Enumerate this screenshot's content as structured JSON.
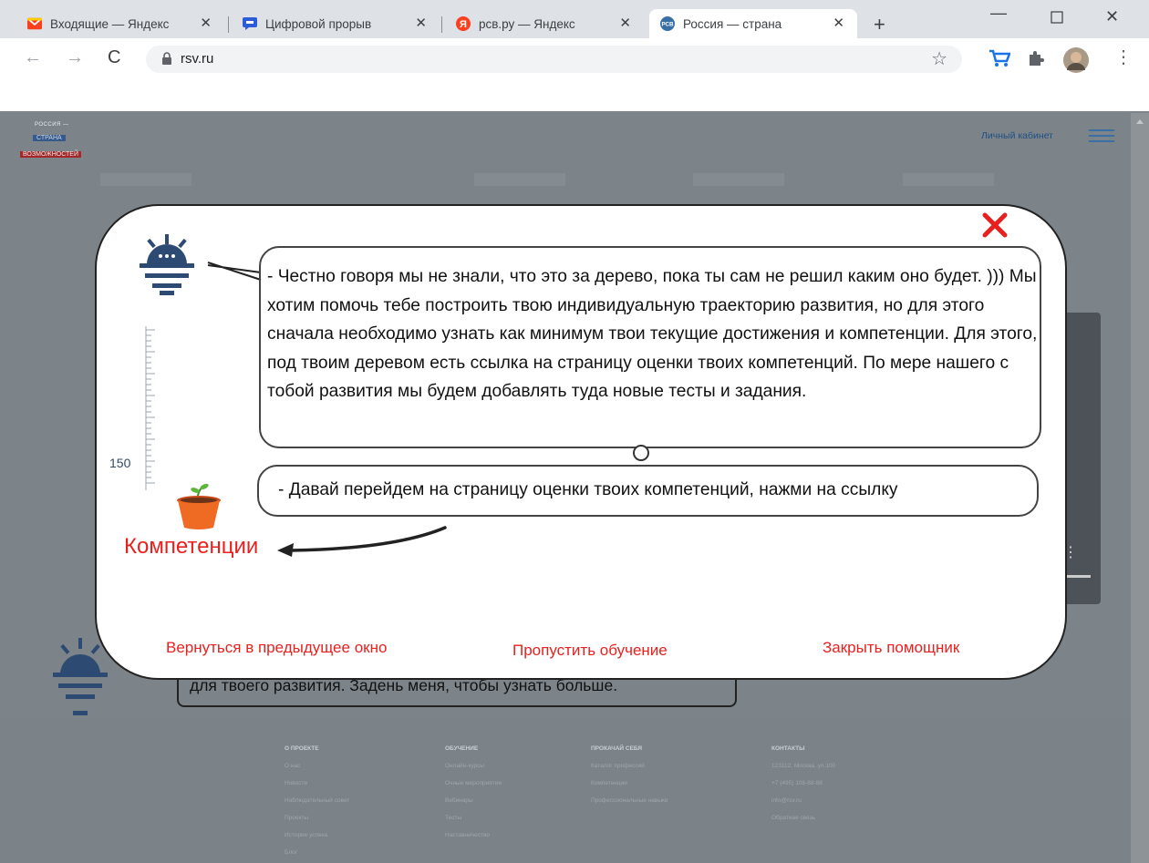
{
  "browser": {
    "tabs": [
      {
        "title": "Входящие — Яндекс",
        "icon": "mail-icon"
      },
      {
        "title": "Цифровой прорыв",
        "icon": "chat-icon"
      },
      {
        "title": "рсв.ру — Яндекс",
        "icon": "yandex-icon"
      },
      {
        "title": "Россия — страна",
        "icon": "rsv-icon",
        "active": true
      }
    ],
    "url": "rsv.ru"
  },
  "site": {
    "logo_lines": [
      "РОССИЯ —",
      "СТРАНА",
      "ВОЗМОЖНОСТЕЙ"
    ],
    "cabinet": "Личный кабинет",
    "behind_text": "для твоего развития. Задень меня, чтобы узнать больше.",
    "footer": [
      {
        "heading": "О ПРОЕКТЕ",
        "items": [
          "О нас",
          "Новости",
          "Наблюдательный совет",
          "Проекты",
          "Истории успеха",
          "Блог"
        ]
      },
      {
        "heading": "ОБУЧЕНИЕ",
        "items": [
          "Онлайн-курсы",
          "Очные мероприятия",
          "Вебинары",
          "Тесты",
          "Наставничество"
        ]
      },
      {
        "heading": "ПРОКАЧАЙ СЕБЯ",
        "items": [
          "Каталог профессий",
          "Компетенции",
          "Профессиональные навыки"
        ]
      },
      {
        "heading": "КОНТАКТЫ",
        "items": [
          "123112, Москва, ул.100",
          "+7 (495) 108-88-88",
          "info@rsv.ru",
          "",
          "Обратная связь"
        ]
      }
    ]
  },
  "assistant": {
    "message": "- Честно говоря мы не знали, что это за дерево, пока ты сам не решил каким оно будет. ))) Мы хотим помочь тебе построить твою индивидуальную траекторию развития, но для этого сначала необходимо узнать как минимум твои текущие достижения и компетенции. Для этого, под твоим деревом есть ссылка на страницу оценки твоих компетенций. По мере нашего с тобой развития мы будем добавлять туда новые тесты и задания.",
    "prompt": "- Давай перейдем на страницу оценки твоих компетенций, нажми на ссылку",
    "ruler_value": "150",
    "competencies_link": "Компетенции",
    "back_label": "Вернуться в предыдущее окно",
    "skip_label": "Пропустить обучение",
    "close_label": "Закрыть помощник"
  },
  "colors": {
    "accent_red": "#e8211f",
    "mascot_blue": "#2d4a72"
  }
}
